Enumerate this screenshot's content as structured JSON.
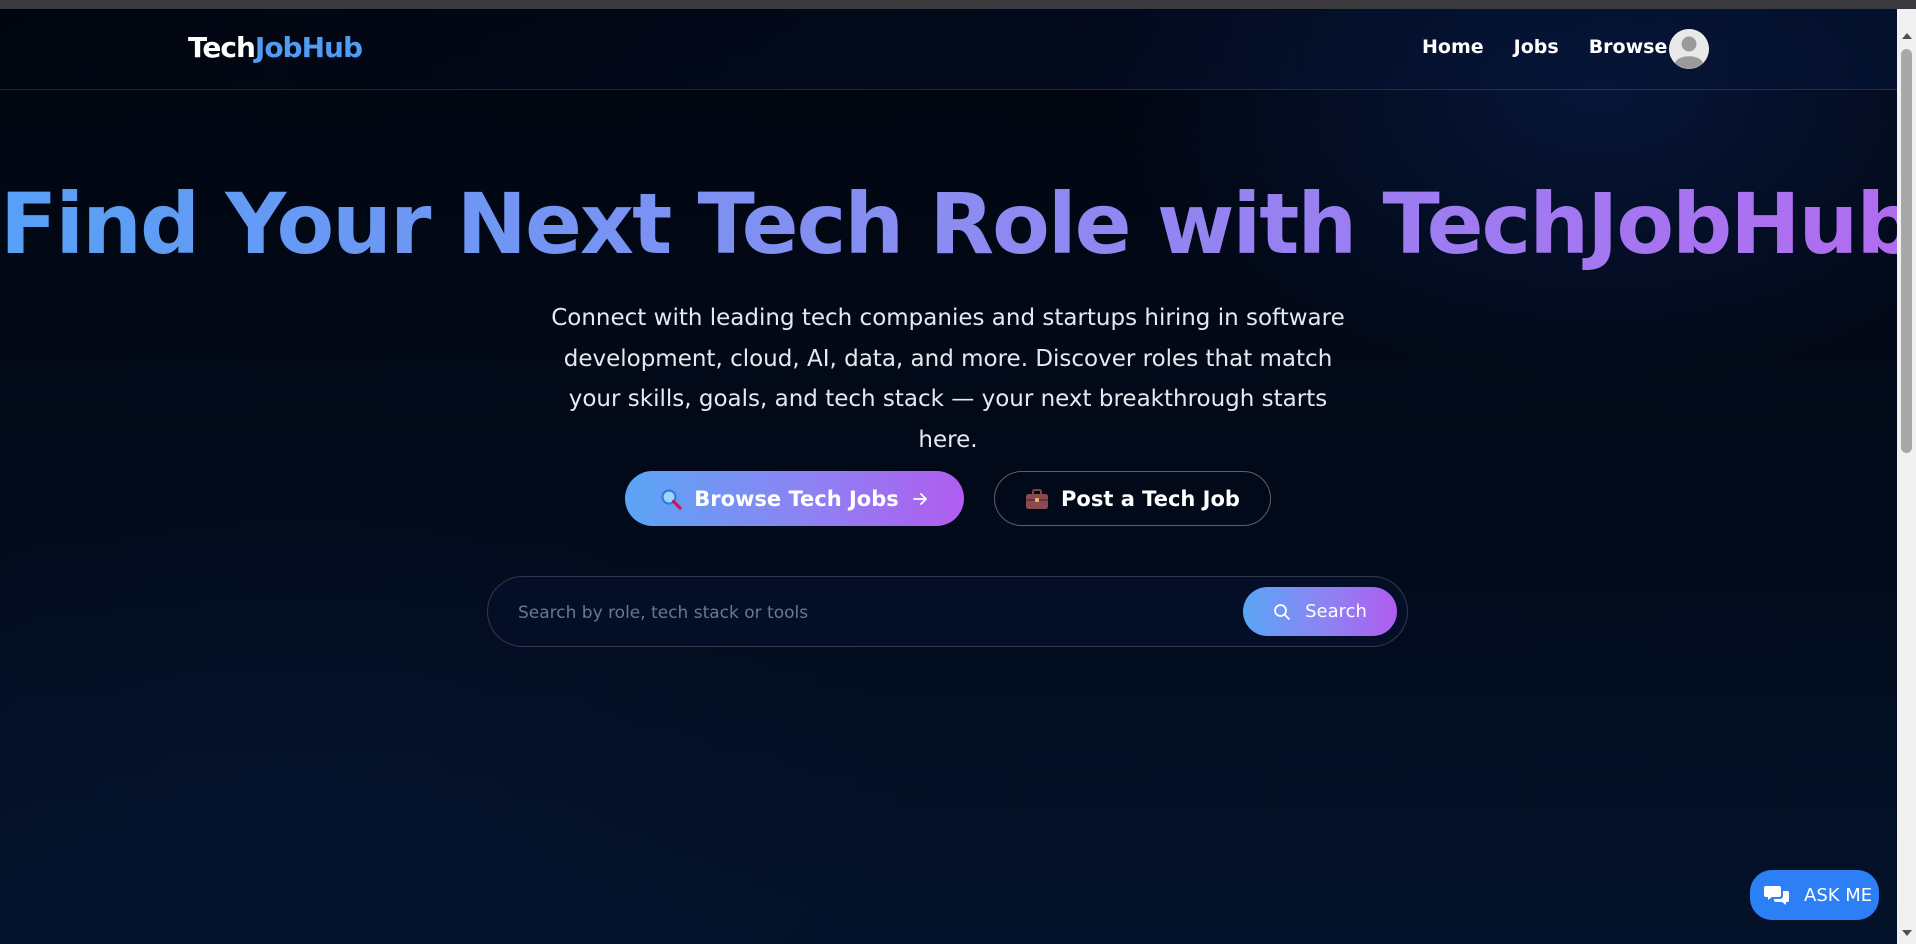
{
  "brand": {
    "part1": "Tech",
    "part2": "JobHub",
    "primary_color": "#4f9cf2"
  },
  "nav": {
    "items": [
      {
        "label": "Home"
      },
      {
        "label": "Jobs"
      },
      {
        "label": "Browse"
      }
    ]
  },
  "hero": {
    "title": "Find Your Next Tech Role with TechJobHub",
    "subtitle": "Connect with leading tech companies and startups hiring in software development, cloud, AI, data, and more. Discover roles that match your skills, goals, and tech stack — your next breakthrough starts here.",
    "primary_cta": {
      "label": "Browse Tech Jobs",
      "icon": "magnifier-icon",
      "trailing_icon": "arrow-right-icon"
    },
    "secondary_cta": {
      "label": "Post a Tech Job",
      "icon": "briefcase-icon"
    }
  },
  "search": {
    "placeholder": "Search by role, tech stack or tools",
    "value": "",
    "button_label": "Search",
    "button_icon": "search-icon"
  },
  "chat": {
    "label": "ASK ME",
    "icon": "chat-icon",
    "color": "#2d7ff5"
  },
  "colors": {
    "gradient_start": "#56a0f5",
    "gradient_end": "#b06cf0",
    "background": "#01050f"
  }
}
